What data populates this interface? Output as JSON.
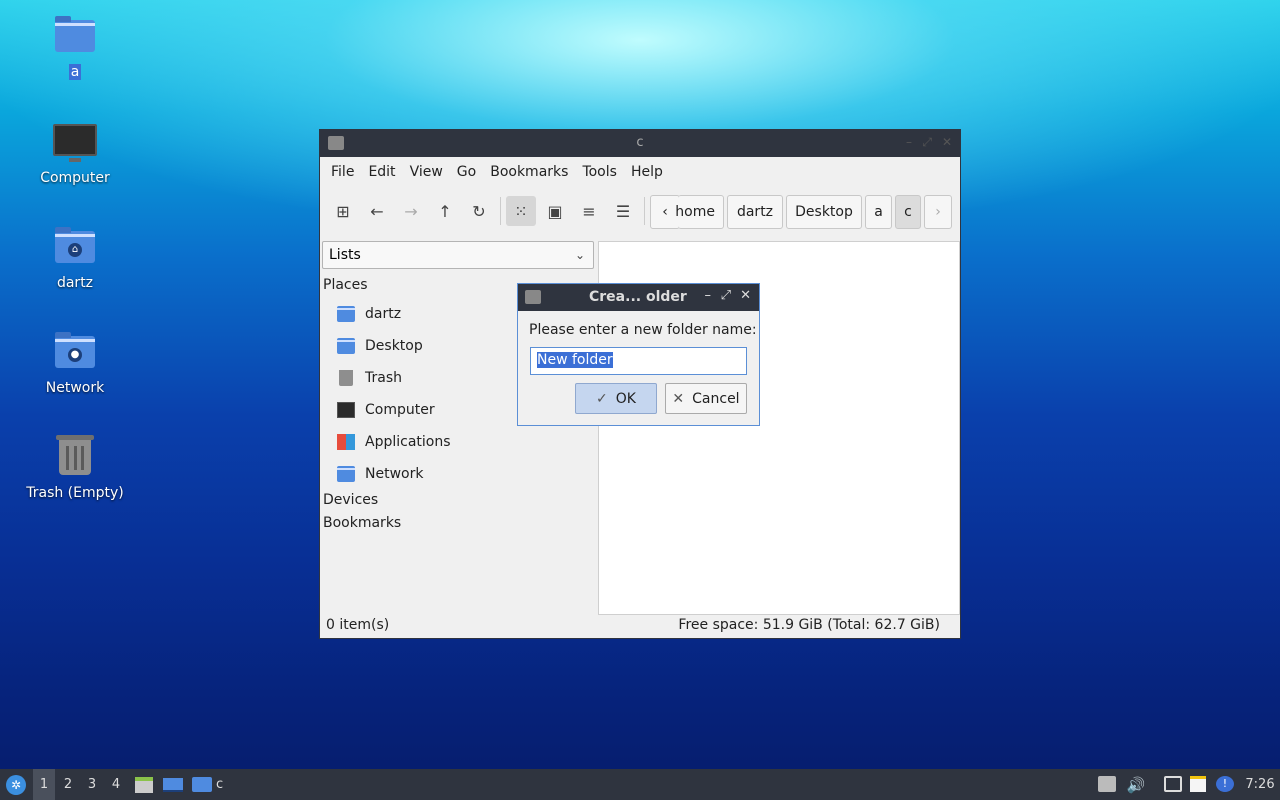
{
  "desktop": {
    "icons": [
      {
        "label": "a",
        "icon": "folder-icon"
      },
      {
        "label": "Computer",
        "icon": "computer-icon"
      },
      {
        "label": "dartz",
        "icon": "home-folder-icon"
      },
      {
        "label": "Network",
        "icon": "network-folder-icon"
      },
      {
        "label": "Trash (Empty)",
        "icon": "trash-icon"
      }
    ]
  },
  "file_manager": {
    "title": "c",
    "menu": [
      "File",
      "Edit",
      "View",
      "Go",
      "Bookmarks",
      "Tools",
      "Help"
    ],
    "path": [
      "home",
      "dartz",
      "Desktop",
      "a",
      "c"
    ],
    "side_pane_mode": "Lists",
    "sections": {
      "places": "Places",
      "devices": "Devices",
      "bookmarks": "Bookmarks"
    },
    "places": [
      "dartz",
      "Desktop",
      "Trash",
      "Computer",
      "Applications",
      "Network"
    ],
    "status": {
      "items": "0 item(s)",
      "free_space": "Free space: 51.9 GiB (Total: 62.7 GiB)"
    }
  },
  "dialog": {
    "title": "Crea... older",
    "prompt": "Please enter a new folder name:",
    "input_value": "New folder",
    "ok_label": "OK",
    "cancel_label": "Cancel"
  },
  "taskbar": {
    "workspaces": [
      "1",
      "2",
      "3",
      "4"
    ],
    "window_label": "c",
    "clock": "7:26"
  }
}
